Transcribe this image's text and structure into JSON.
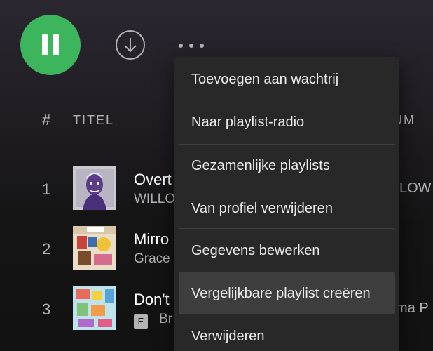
{
  "toolbar": {
    "play_state": "pause",
    "accent_color": "#3cb55d"
  },
  "tracklist": {
    "headers": {
      "number": "#",
      "title": "TITEL",
      "album": "UM"
    },
    "tracks": [
      {
        "number": "1",
        "title": "Overt",
        "artist": "WILLO",
        "album": "LOW",
        "explicit": false
      },
      {
        "number": "2",
        "title": "Mirro",
        "artist": "Grace",
        "album": "",
        "explicit": false
      },
      {
        "number": "3",
        "title": "Don't",
        "artist": "Br",
        "album": "ma P",
        "explicit": true,
        "explicit_label": "E"
      }
    ]
  },
  "context_menu": {
    "items": [
      {
        "label": "Toevoegen aan wachtrij"
      },
      {
        "label": "Naar playlist-radio"
      },
      {
        "label": "Gezamenlijke playlists"
      },
      {
        "label": "Van profiel verwijderen"
      },
      {
        "label": "Gegevens bewerken"
      },
      {
        "label": "Vergelijkbare playlist creëren",
        "highlighted": true
      },
      {
        "label": "Verwijderen"
      }
    ]
  }
}
